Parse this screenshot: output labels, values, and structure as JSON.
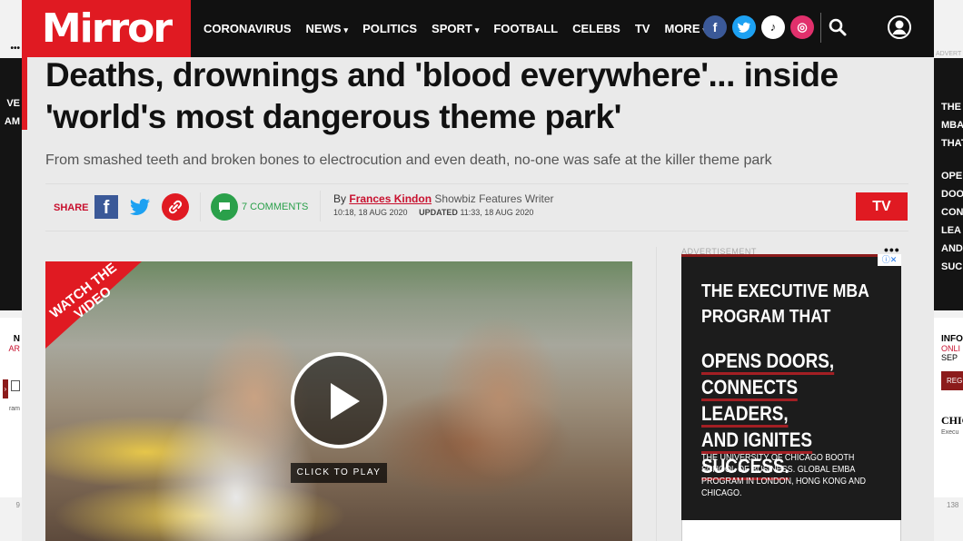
{
  "header": {
    "logo": "Mirror",
    "nav": [
      {
        "label": "CORONAVIRUS",
        "has_caret": false
      },
      {
        "label": "NEWS",
        "has_caret": true
      },
      {
        "label": "POLITICS",
        "has_caret": false
      },
      {
        "label": "SPORT",
        "has_caret": true
      },
      {
        "label": "FOOTBALL",
        "has_caret": false
      },
      {
        "label": "CELEBS",
        "has_caret": false
      },
      {
        "label": "TV",
        "has_caret": false
      },
      {
        "label": "MORE",
        "has_caret": true
      }
    ],
    "socials": [
      {
        "icon": "facebook-icon",
        "glyph": "f"
      },
      {
        "icon": "twitter-icon",
        "glyph": "t"
      },
      {
        "icon": "tiktok-icon",
        "glyph": "♪"
      },
      {
        "icon": "instagram-icon",
        "glyph": "◎"
      }
    ],
    "caret": "▾"
  },
  "article": {
    "headline": "Deaths, drownings and 'blood everywhere'... inside 'world's most dangerous theme park'",
    "standfirst": "From smashed teeth and broken bones to electrocution and even death, no-one was safe at the killer theme park",
    "share_label": "SHARE",
    "comments": "7 COMMENTS",
    "byline_prefix": "By",
    "author": "Frances Kindon",
    "author_role": "Showbiz Features Writer",
    "published": "10:18, 18 AUG 2020",
    "updated_label": "UPDATED",
    "updated": "11:33, 18 AUG 2020",
    "section_badge": "TV"
  },
  "video": {
    "corner_label": "WATCH THE VIDEO",
    "play_caption": "CLICK TO PLAY"
  },
  "sidebar_ad": {
    "label": "ADVERTISEMENT",
    "dots": "•••",
    "headline": "THE EXECUTIVE MBA PROGRAM THAT",
    "line1": "OPENS DOORS,",
    "line2": "CONNECTS LEADERS,",
    "line3": "AND IGNITES SUCCESS.",
    "small": "THE UNIVERSITY OF CHICAGO BOOTH SCHOOL OF BUSINESS. GLOBAL EMBA PROGRAM IN LONDON, HONG KONG AND CHICAGO.",
    "brand_color": "#8c1b1b"
  },
  "left_skin": {
    "dots": "•••",
    "lines": [
      "VE",
      "AM"
    ],
    "light_line1": "N",
    "light_red": "AR",
    "small": "ram",
    "num": "9"
  },
  "right_skin": {
    "adtag": "ADVERT",
    "lines": [
      "THE",
      "MBA",
      "THAT",
      "",
      "OPE",
      "DOO",
      "CON",
      "LEA",
      "AND",
      "SUC"
    ],
    "light_line1": "INFO",
    "light_red": "ONLI",
    "light_line3": "SEP",
    "btn": "REG",
    "brand": "CHIC",
    "small": "Execu",
    "num": "138"
  },
  "colors": {
    "brand_red": "#e01a22",
    "comments_green": "#2aa04a",
    "header_bg": "#111111"
  }
}
